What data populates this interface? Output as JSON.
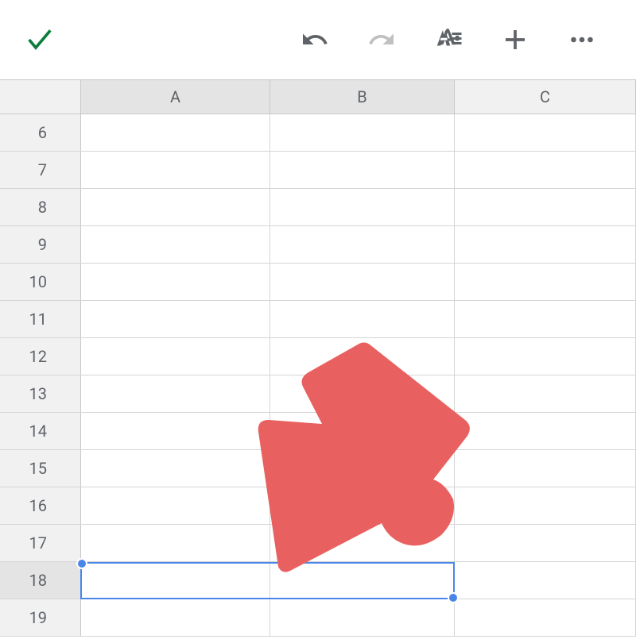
{
  "toolbar": {
    "confirm": "check",
    "undo": "undo",
    "redo": "redo",
    "format": "format",
    "add": "add",
    "more": "more"
  },
  "columns": [
    "A",
    "B",
    "C"
  ],
  "rows": [
    "6",
    "7",
    "8",
    "9",
    "10",
    "11",
    "12",
    "13",
    "14",
    "15",
    "16",
    "17",
    "18",
    "19"
  ],
  "selection": {
    "range": "A18:B18",
    "selected_row": "18"
  },
  "colors": {
    "selection_border": "#4a86e8",
    "annotation_arrow": "#e96060"
  }
}
